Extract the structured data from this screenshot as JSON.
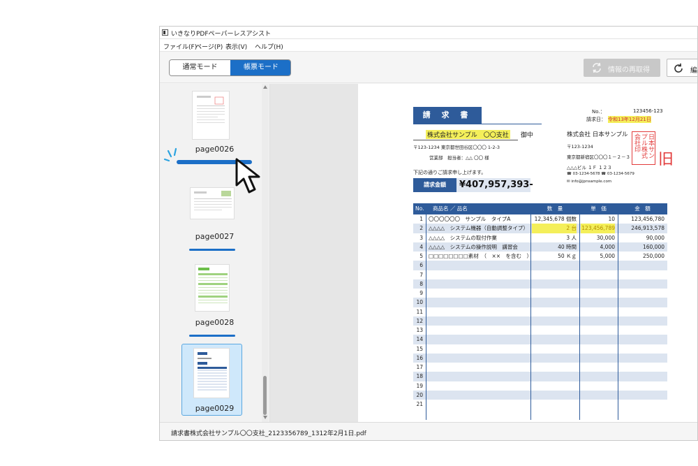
{
  "window": {
    "title": "いきなりPDFペーパーレスアシスト",
    "menu": [
      "ファイル(F)",
      "ページ(P)",
      "表示(V)",
      "ヘルプ(H)"
    ]
  },
  "toolbar": {
    "mode_normal": "通常モード",
    "mode_form": "帳票モード",
    "refetch": "情報の再取得",
    "edit": "編"
  },
  "thumbnails": [
    {
      "label": "page0026"
    },
    {
      "label": "page0027"
    },
    {
      "label": "page0028"
    },
    {
      "label": "page0029"
    }
  ],
  "status": {
    "filename": "請求書株式会社サンプル〇〇支社_2123356789_1312年2月1日.pdf"
  },
  "invoice": {
    "title": "請 求 書",
    "no_label": "No.：",
    "no_value": "123456-123",
    "date_label": "請求日：",
    "date_value": "令和13年12月21日",
    "recipient": "株式会社サンプル　〇〇支社",
    "honorific": "御中",
    "recipient_address": "〒123-1234 東京都世田谷区〇〇〇 1-2-3",
    "recipient_dept": "営業部　担当者：△△ 〇〇 様",
    "issuer_name": "株式会社 日本サンプル",
    "issuer_zip": "〒123-1234",
    "issuer_address": "東京都新宿区〇〇〇１－２－３",
    "issuer_building": "△△△ビル １Ｆ １２３",
    "issuer_tel": "☎ 03-1234-5678 ☎ 03-1234-5679",
    "issuer_mail": "✉ info@jpnsample.com",
    "intro": "下記の通りご請求申し上げます。",
    "amount_label": "請求金額",
    "amount_value": "¥407,957,393-",
    "table_headers": [
      "No.",
      "商品名 ／ 品名",
      "数　量",
      "単　価",
      "金　額"
    ],
    "rows": [
      {
        "no": "1",
        "name": "〇〇〇〇〇〇　サンプル　タイプA",
        "qty": "12,345,678 個数",
        "price": "10",
        "amount": "123,456,780"
      },
      {
        "no": "2",
        "name": "△△△△　システム機器（自動調整タイプ）",
        "qty": "2 台",
        "price": "123,456,789",
        "amount": "246,913,578"
      },
      {
        "no": "3",
        "name": "△△△△　システムの取付作業",
        "qty": "3 人",
        "price": "30,000",
        "amount": "90,000"
      },
      {
        "no": "4",
        "name": "△△△△　システムの操作説明　講習会",
        "qty": "40 時間",
        "price": "4,000",
        "amount": "160,000"
      },
      {
        "no": "5",
        "name": "□□□□□□□□素材　（　××　を含む　）",
        "qty": "50 Ｋｇ",
        "price": "5,000",
        "amount": "250,000"
      },
      {
        "no": "6",
        "name": "",
        "qty": "",
        "price": "",
        "amount": ""
      },
      {
        "no": "7",
        "name": "",
        "qty": "",
        "price": "",
        "amount": ""
      },
      {
        "no": "8",
        "name": "",
        "qty": "",
        "price": "",
        "amount": ""
      },
      {
        "no": "9",
        "name": "",
        "qty": "",
        "price": "",
        "amount": ""
      },
      {
        "no": "10",
        "name": "",
        "qty": "",
        "price": "",
        "amount": ""
      },
      {
        "no": "11",
        "name": "",
        "qty": "",
        "price": "",
        "amount": ""
      },
      {
        "no": "12",
        "name": "",
        "qty": "",
        "price": "",
        "amount": ""
      },
      {
        "no": "13",
        "name": "",
        "qty": "",
        "price": "",
        "amount": ""
      },
      {
        "no": "14",
        "name": "",
        "qty": "",
        "price": "",
        "amount": ""
      },
      {
        "no": "15",
        "name": "",
        "qty": "",
        "price": "",
        "amount": ""
      },
      {
        "no": "16",
        "name": "",
        "qty": "",
        "price": "",
        "amount": ""
      },
      {
        "no": "17",
        "name": "",
        "qty": "",
        "price": "",
        "amount": ""
      },
      {
        "no": "18",
        "name": "",
        "qty": "",
        "price": "",
        "amount": ""
      },
      {
        "no": "19",
        "name": "",
        "qty": "",
        "price": "",
        "amount": ""
      },
      {
        "no": "20",
        "name": "",
        "qty": "",
        "price": "",
        "amount": ""
      },
      {
        "no": "21",
        "name": "",
        "qty": "",
        "price": "",
        "amount": ""
      }
    ],
    "stamp_text": "日本サンプル株式会社印",
    "stamp_cut": "旧"
  },
  "colors": {
    "accent": "#1c6fc7",
    "invoice_navy": "#2e5b9a",
    "highlight": "#f4ef5a",
    "stamp_red": "#e23b3b"
  }
}
